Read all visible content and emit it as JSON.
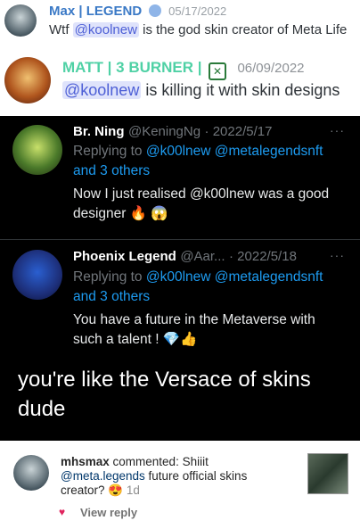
{
  "discord_msg1": {
    "username": "Max | LEGEND",
    "date": "05/17/2022",
    "text_before": "Wtf ",
    "mention": "@koolnew",
    "text_after": " is the god skin creator of Meta Life"
  },
  "discord_msg2": {
    "username": "MATT | 3 BURNER |",
    "date": "06/09/2022",
    "mention": "@koolnew",
    "text_after": " is killing it with skin designs"
  },
  "tweet1": {
    "name": "Br. Ning",
    "handle": "@KeningNg",
    "date": "· 2022/5/17",
    "replying_prefix": "Replying to ",
    "replying_users": "@k00lnew @metalegendsnft",
    "replying_more": "and 3 others",
    "text": "Now I just realised @k00lnew was a good designer",
    "emoji": "🔥 😱"
  },
  "tweet2": {
    "name": "Phoenix Legend",
    "handle": "@Aar...",
    "date": "· 2022/5/18",
    "replying_prefix": "Replying to ",
    "replying_users": "@k00lnew @metalegendsnft",
    "replying_more": "and 3 others",
    "text": "You have a future in the Metaverse with such a talent !",
    "emoji": "💎👍"
  },
  "big_message": {
    "text": "you're like the Versace of skins dude"
  },
  "instagram": {
    "username": "mhsmax",
    "action": " commented: Shiiit",
    "mention": "@meta.legends",
    "text": " future official skins creator?",
    "emoji": "😍",
    "time": "1d",
    "view_reply": "View reply"
  },
  "colors": {
    "discord_name1": "#3a79c6",
    "discord_name2": "#4fd1a5",
    "mention_bg": "#dfe3fb",
    "mention_text": "#4d5fd6",
    "twitter_link": "#1d9bf0"
  }
}
